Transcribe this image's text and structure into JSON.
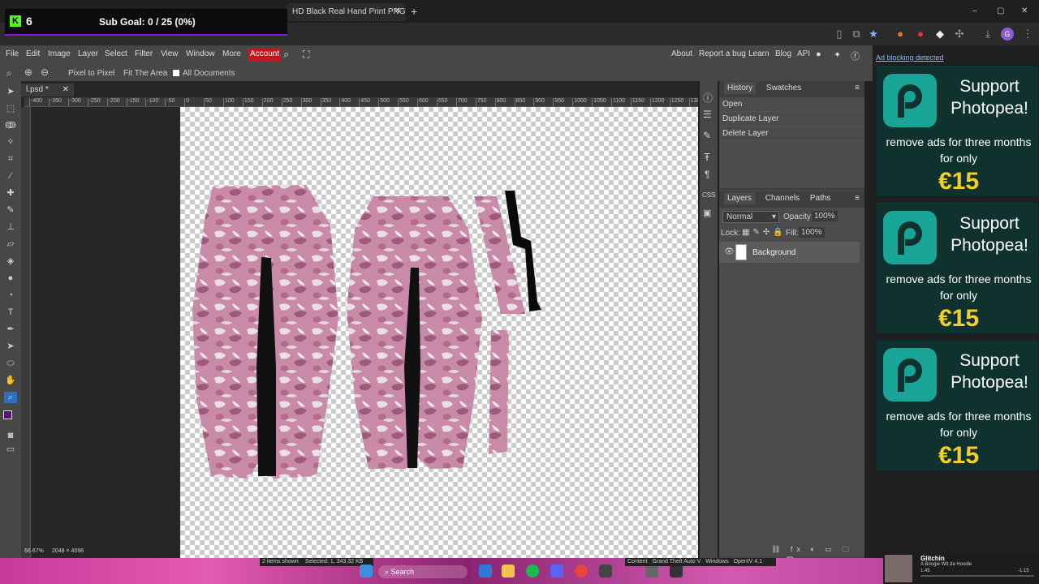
{
  "browser": {
    "tabs": [
      {
        "label": "HD Black Real Hand Print PNG"
      }
    ],
    "new_tab": "+",
    "window_controls": [
      "–",
      "▢",
      "✕"
    ]
  },
  "stream_overlay": {
    "kick_count": "6",
    "sub_goal": "Sub Goal: 0 / 25 (0%)"
  },
  "menubar": {
    "items": [
      "File",
      "Edit",
      "Image",
      "Layer",
      "Select",
      "Filter",
      "View",
      "Window",
      "More"
    ],
    "account": "Account",
    "right_links": [
      "About",
      "Report a bug",
      "Learn",
      "Blog",
      "API"
    ]
  },
  "options_bar": {
    "pixel_to_pixel": "Pixel to Pixel",
    "fit_area": "Fit The Area",
    "all_documents": "All Documents"
  },
  "document": {
    "tab_name": "l.psd *",
    "ruler_ticks": [
      "-400",
      "-350",
      "-300",
      "-250",
      "-200",
      "-150",
      "-100",
      "-50",
      "0",
      "50",
      "100",
      "150",
      "200",
      "250",
      "300",
      "350",
      "400",
      "450",
      "500",
      "550",
      "600",
      "650",
      "700",
      "750",
      "800",
      "850",
      "900",
      "950",
      "1000",
      "1050",
      "1100",
      "1150",
      "1200",
      "1250",
      "1300",
      "1350",
      "1400"
    ],
    "zoom": "66.67%",
    "size": "2048 × 4096"
  },
  "history_panel": {
    "tabs": [
      "History",
      "Swatches"
    ],
    "items": [
      "Open",
      "Duplicate Layer",
      "Delete Layer"
    ]
  },
  "layers_panel": {
    "tabs": [
      "Layers",
      "Channels",
      "Paths"
    ],
    "blend_mode": "Normal",
    "opacity_label": "Opacity:",
    "opacity": "100%",
    "lock_label": "Lock:",
    "fill_label": "Fill:",
    "fill": "100%",
    "layers": [
      {
        "name": "Background"
      }
    ]
  },
  "ads": {
    "notice": "Ad blocking detected",
    "title": "Support Photopea!",
    "body": "remove ads for three months for only",
    "price": "€15"
  },
  "taskbar": {
    "items_shown": "2 items shown",
    "selected": "Selected: 1, 343.32 KB",
    "search": "Search",
    "tray": [
      "Content",
      "Grand Theft Auto V",
      "Windows",
      "OpenIV 4.1"
    ],
    "media_title": "Glitchin",
    "media_artist": "A Boogie Wit da Hoodie",
    "media_elapsed": "1:45",
    "media_remaining": "-1:15"
  },
  "colors": {
    "accent": "#18a497",
    "price": "#f3cf24",
    "account": "#c4141e",
    "kick": "#53fc18"
  }
}
